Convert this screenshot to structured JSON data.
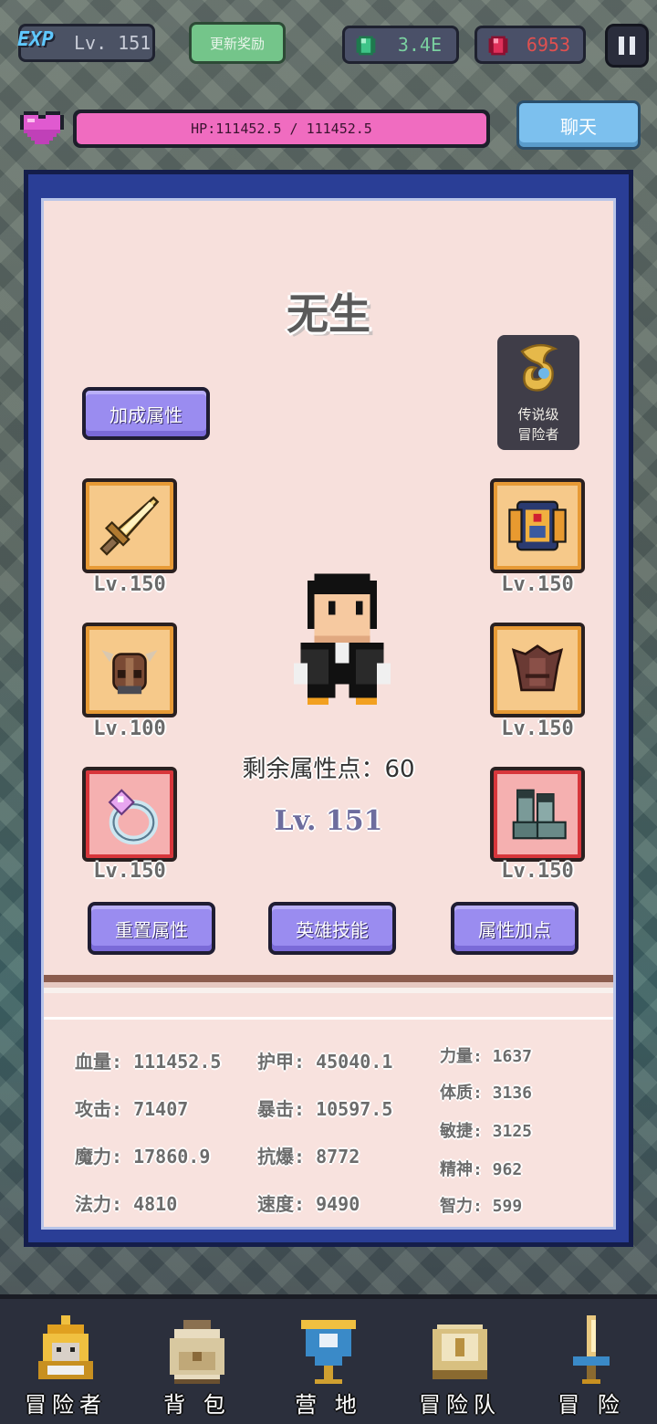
{
  "header": {
    "exp_badge": "EXP",
    "exp_level": "Lv. 151",
    "update_reward_label": "更新奖励",
    "gem_amount": "3.4E",
    "ruby_amount": "6953",
    "hp_text": "HP:111452.5 / 111452.5",
    "hp_fraction": 1.0,
    "chat_label": "聊天"
  },
  "hero": {
    "name": "无生",
    "rank_line1": "传说级",
    "rank_line2": "冒险者",
    "bonus_attr_label": "加成属性",
    "remaining_points": "剩余属性点：60",
    "level": "Lv. 151"
  },
  "equipment": {
    "weapon_level": "Lv.150",
    "chest_level": "Lv.150",
    "helmet_level": "Lv.100",
    "armor_level": "Lv.150",
    "ring_level": "Lv.150",
    "boots_level": "Lv.150"
  },
  "actions": {
    "reset_attr": "重置属性",
    "hero_skill": "英雄技能",
    "add_points": "属性加点"
  },
  "stats": {
    "hp": "血量: 111452.5",
    "armor": "护甲: 45040.1",
    "attack": "攻击: 71407",
    "crit": "暴击: 10597.5",
    "magic": "魔力: 17860.9",
    "anti_crit": "抗爆: 8772",
    "mana": "法力: 4810",
    "speed": "速度: 9490",
    "strength": "力量: 1637",
    "constitution": "体质: 3136",
    "agility": "敏捷: 3125",
    "spirit": "精神: 962",
    "intelligence": "智力: 599"
  },
  "nav": {
    "adventurer": "冒险者",
    "backpack": "背 包",
    "camp": "营 地",
    "party": "冒险队",
    "adventure": "冒 险"
  }
}
